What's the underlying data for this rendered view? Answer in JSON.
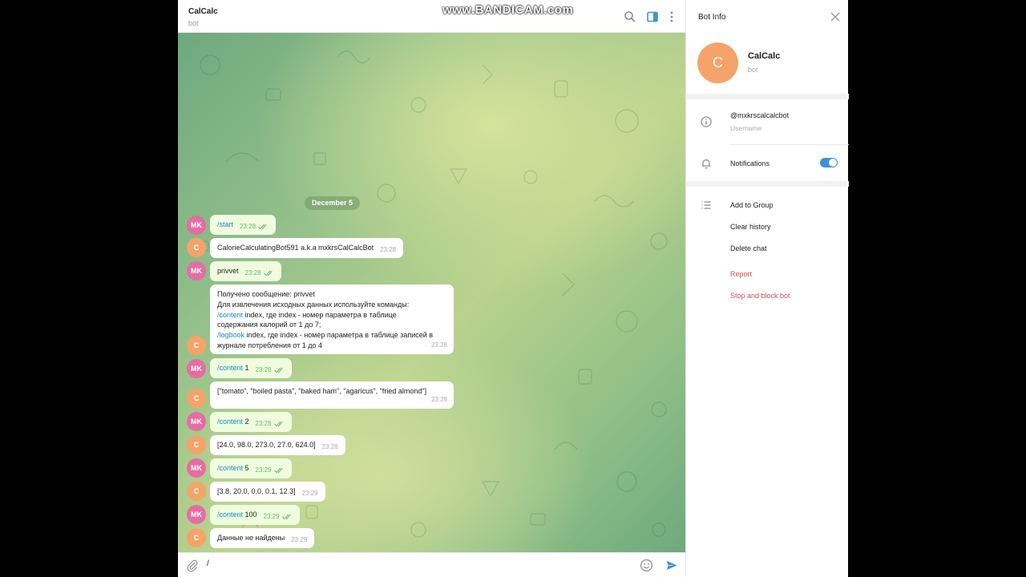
{
  "watermark": "www.BANDICAM.com",
  "chat": {
    "title": "CalCalc",
    "subtitle": "bot",
    "date_divider": "December 5",
    "composer_value": "/"
  },
  "messages": [
    {
      "from": "MK",
      "cmd": "/start",
      "text": "",
      "time": "23:28"
    },
    {
      "from": "C",
      "cmd": "",
      "text": "CalorieCalculatingBot591 a.k.a mxkrsCalCalcBot",
      "time": "23:28"
    },
    {
      "from": "MK",
      "cmd": "",
      "text": "privvet",
      "time": "23:28"
    },
    {
      "from": "C",
      "line1": "Получено сообщение: privvet",
      "line2": "Для извлечения исходных данных используйте команды:",
      "cmd1": "/content",
      "line3": " index, где index - номер параметра в таблице",
      "line4": "содержания калорий от 1 до 7;",
      "cmd2": "/logbook",
      "line5": " index, где index - номер параметра в таблице записей в",
      "line6": "журнале потребления от 1 до 4",
      "time": "23:28"
    },
    {
      "from": "MK",
      "cmd": "/content",
      "text": " 1",
      "time": "23:28"
    },
    {
      "from": "C",
      "cmd": "",
      "text": "[\"tomato\", \"boiled pasta\", \"baked ham\", \"agaricus\", \"fried almond\"]",
      "time": "23:28"
    },
    {
      "from": "MK",
      "cmd": "/content",
      "text": " 2",
      "time": "23:28"
    },
    {
      "from": "C",
      "cmd": "",
      "text": "[24.0, 98.0, 273.0, 27.0, 624.0]",
      "time": "23:28"
    },
    {
      "from": "MK",
      "cmd": "/content",
      "text": " 5",
      "time": "23:29"
    },
    {
      "from": "C",
      "cmd": "",
      "text": "[3.8, 20.0, 0.0, 0.1, 12.3]",
      "time": "23:29"
    },
    {
      "from": "MK",
      "cmd": "/content",
      "text": " 100",
      "time": "23:29"
    },
    {
      "from": "C",
      "cmd": "",
      "text": "Данные не найдены",
      "time": "23:29"
    }
  ],
  "avatars": {
    "user_initials": "MK",
    "bot_initial": "C"
  },
  "panel": {
    "title": "Bot Info",
    "name": "CalCalc",
    "status": "bot",
    "avatar_letter": "C",
    "username": "@mxkrscalcalcbot",
    "username_label": "Username",
    "notifications_label": "Notifications",
    "notifications_on": true,
    "add_to_group": "Add to Group",
    "clear_history": "Clear history",
    "delete_chat": "Delete chat",
    "report": "Report",
    "stop_and_block": "Stop and block bot"
  },
  "colors": {
    "accent": "#3b93d6",
    "link": "#168acd",
    "danger": "#d14e4e",
    "outgoing_bubble": "#effdde",
    "user_avatar": "#e56da3",
    "bot_avatar": "#f4a46a"
  },
  "icons": [
    "search-icon",
    "sidebar-toggle-icon",
    "more-vertical-icon",
    "info-icon",
    "bell-icon",
    "list-icon",
    "close-icon",
    "paperclip-icon",
    "emoji-icon",
    "send-icon",
    "double-check-icon"
  ]
}
